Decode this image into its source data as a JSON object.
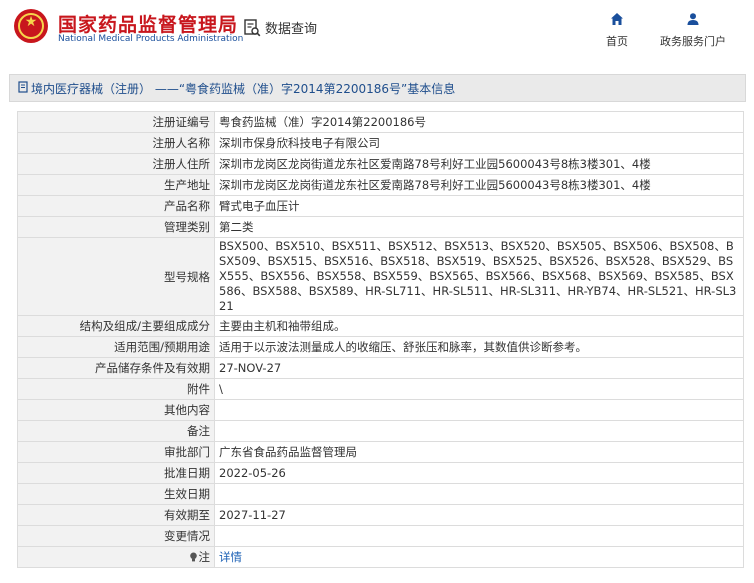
{
  "header": {
    "site_name_cn": "国家药品监督管理局",
    "site_name_en": "National Medical Products Administration",
    "data_query_label": "数据查询",
    "nav_home": "首页",
    "nav_gov_portal": "政务服务门户"
  },
  "title_bar": {
    "text": "境内医疗器械（注册） ——“粤食药监械（准）字2014第2200186号”基本信息"
  },
  "rows": [
    {
      "label": "注册证编号",
      "value": "粤食药监械（准）字2014第2200186号"
    },
    {
      "label": "注册人名称",
      "value": "深圳市保身欣科技电子有限公司"
    },
    {
      "label": "注册人住所",
      "value": "深圳市龙岗区龙岗街道龙东社区爱南路78号利好工业园5600043号8栋3楼301、4楼"
    },
    {
      "label": "生产地址",
      "value": "深圳市龙岗区龙岗街道龙东社区爱南路78号利好工业园5600043号8栋3楼301、4楼"
    },
    {
      "label": "产品名称",
      "value": "臂式电子血压计"
    },
    {
      "label": "管理类别",
      "value": "第二类"
    },
    {
      "label": "型号规格",
      "value": "BSX500、BSX510、BSX511、BSX512、BSX513、BSX520、BSX505、BSX506、BSX508、BSX509、BSX515、BSX516、BSX518、BSX519、BSX525、BSX526、BSX528、BSX529、BSX555、BSX556、BSX558、BSX559、BSX565、BSX566、BSX568、BSX569、BSX585、BSX586、BSX588、BSX589、HR-SL711、HR-SL511、HR-SL311、HR-YB74、HR-SL521、HR-SL321"
    },
    {
      "label": "结构及组成/主要组成成分",
      "value": "主要由主机和袖带组成。"
    },
    {
      "label": "适用范围/预期用途",
      "value": "适用于以示波法测量成人的收缩压、舒张压和脉率，其数值供诊断参考。"
    },
    {
      "label": "产品储存条件及有效期",
      "value": "27-NOV-27"
    },
    {
      "label": "附件",
      "value": "\\"
    },
    {
      "label": "其他内容",
      "value": ""
    },
    {
      "label": "备注",
      "value": ""
    },
    {
      "label": "审批部门",
      "value": "广东省食品药品监督管理局"
    },
    {
      "label": "批准日期",
      "value": "2022-05-26"
    },
    {
      "label": "生效日期",
      "value": ""
    },
    {
      "label": "有效期至",
      "value": "2027-11-27"
    },
    {
      "label": "变更情况",
      "value": ""
    },
    {
      "label": "注",
      "value": "详情"
    }
  ],
  "icons": {
    "logo": "national-emblem-icon",
    "data_query": "document-search-icon",
    "home": "home-icon",
    "gov_portal": "user-icon",
    "note": "lightbulb-icon",
    "title_bar": "document-icon"
  },
  "colors": {
    "brand_red": "#c8161d",
    "link_blue": "#1a5fb4",
    "title_blue": "#1f4e8c"
  }
}
